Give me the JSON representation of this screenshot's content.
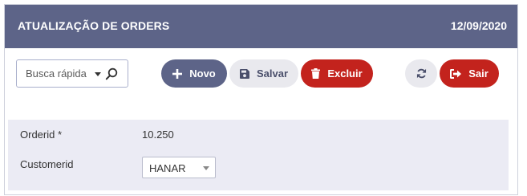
{
  "header": {
    "title": "ATUALIZAÇÃO DE ORDERS",
    "date": "12/09/2020",
    "background_color": "#5d6488"
  },
  "toolbar": {
    "search": {
      "label": "Busca rápida",
      "icon": "search-icon"
    },
    "buttons": {
      "novo": {
        "label": "Novo",
        "icon": "plus-icon",
        "color": "#5d6488"
      },
      "salvar": {
        "label": "Salvar",
        "icon": "save-icon",
        "color": "#e9e9ee"
      },
      "excluir": {
        "label": "Excluir",
        "icon": "trash-icon",
        "color": "#c3231d"
      },
      "refresh": {
        "icon": "refresh-icon",
        "color": "#e9e9ee"
      },
      "sair": {
        "label": "Sair",
        "icon": "sign-out-icon",
        "color": "#c3231d"
      }
    }
  },
  "form": {
    "fields": [
      {
        "label": "Orderid *",
        "value": "10.250"
      },
      {
        "label": "Customerid",
        "value": "HANAR"
      }
    ],
    "background_color": "#ebebf4"
  }
}
